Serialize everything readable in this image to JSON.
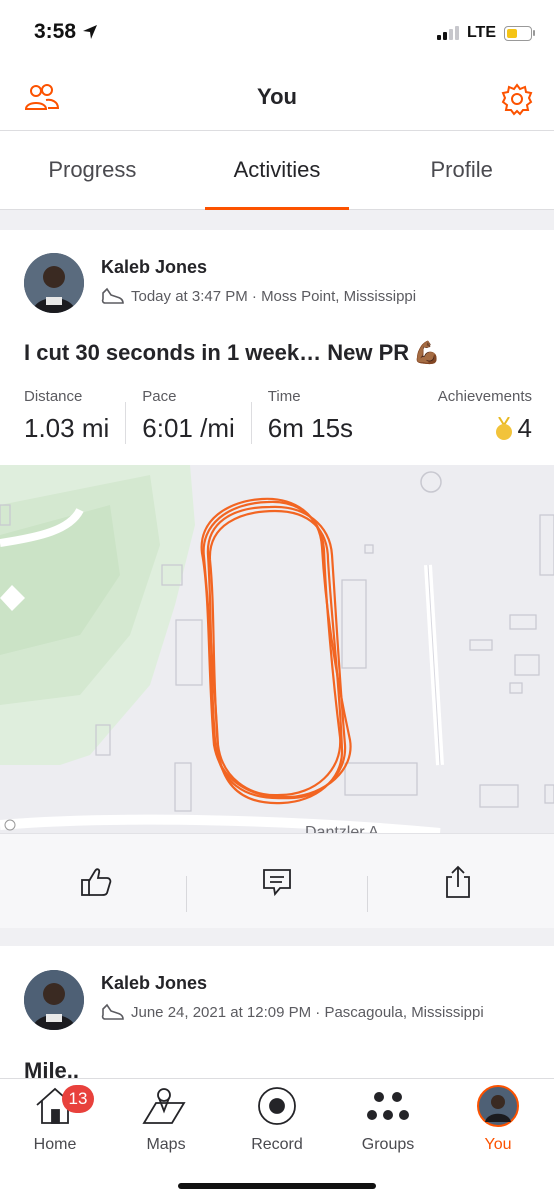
{
  "status_bar": {
    "time": "3:58",
    "network": "LTE",
    "battery_level": 0.4
  },
  "header": {
    "title": "You",
    "left_icon": "people-icon",
    "right_icon": "gear-icon",
    "accent": "#fc5200"
  },
  "tabs": [
    {
      "label": "Progress",
      "active": false
    },
    {
      "label": "Activities",
      "active": true
    },
    {
      "label": "Profile",
      "active": false
    }
  ],
  "activity": {
    "athlete": "Kaleb Jones",
    "timestamp": "Today at 3:47 PM · Moss Point, Mississippi",
    "title": "I cut 30 seconds in 1 week… New PR",
    "title_emoji": "💪🏾",
    "stats": [
      {
        "label": "Distance",
        "value": "1.03 mi"
      },
      {
        "label": "Pace",
        "value": "6:01 /mi"
      },
      {
        "label": "Time",
        "value": "6m 15s"
      }
    ],
    "achievements": {
      "label": "Achievements",
      "value": "4"
    },
    "map": {
      "street_label": "Dantzler A",
      "route_color": "#f26522"
    }
  },
  "actions": [
    "thumbs-up-icon",
    "comment-icon",
    "share-icon"
  ],
  "activity2": {
    "athlete": "Kaleb Jones",
    "timestamp": "June 24, 2021 at 12:09 PM · Pascagoula, Mississippi",
    "title": "Mile.."
  },
  "tabbar": {
    "items": [
      {
        "label": "Home",
        "icon": "home-icon",
        "badge": "13"
      },
      {
        "label": "Maps",
        "icon": "map-icon"
      },
      {
        "label": "Record",
        "icon": "record-icon"
      },
      {
        "label": "Groups",
        "icon": "groups-icon"
      },
      {
        "label": "You",
        "icon": "avatar",
        "active": true
      }
    ]
  }
}
